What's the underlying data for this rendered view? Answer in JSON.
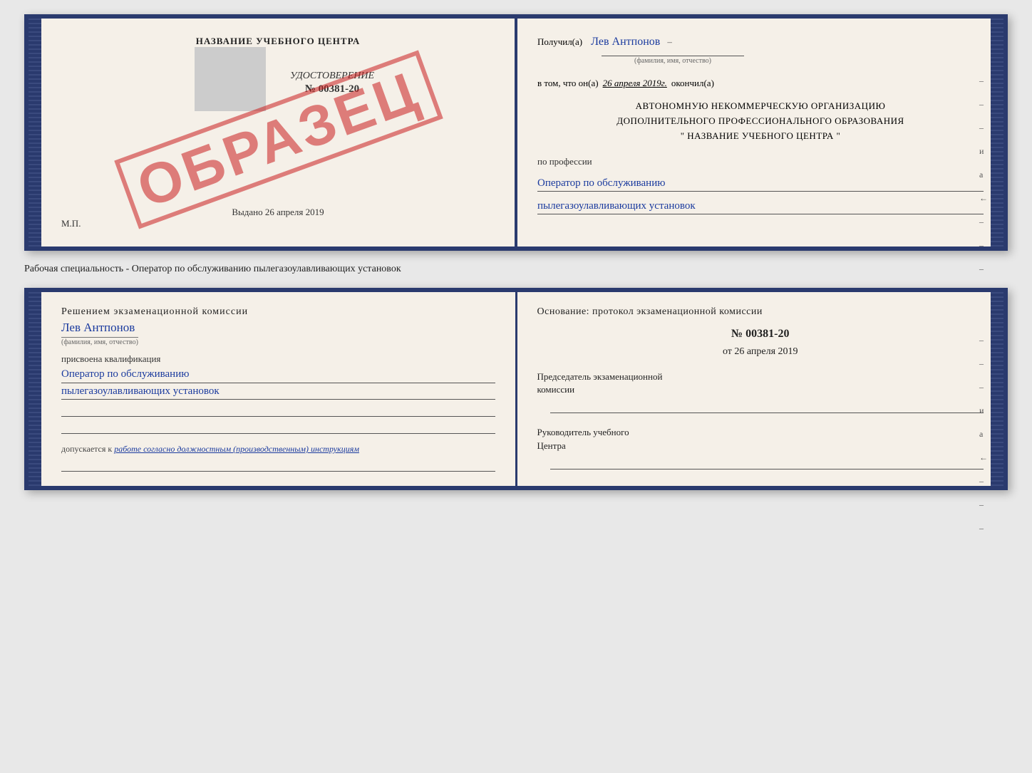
{
  "top_cert": {
    "left": {
      "school_name": "НАЗВАНИЕ УЧЕБНОГО ЦЕНТРА",
      "obrazec": "ОБРАЗЕЦ",
      "udostoverenie_label": "УДОСТОВЕРЕНИЕ",
      "cert_number": "№ 00381-20",
      "vydano": "Выдано 26 апреля 2019",
      "mp": "М.П."
    },
    "right": {
      "poluchil": "Получил(а)",
      "recipient_name": "Лев Антпонов",
      "fio_hint": "(фамилия, имя, отчество)",
      "v_tom_chto": "в том, что он(а)",
      "date": "26 апреля 2019г.",
      "okonchil": "окончил(а)",
      "org_line1": "АВТОНОМНУЮ НЕКОММЕРЧЕСКУЮ ОРГАНИЗАЦИЮ",
      "org_line2": "ДОПОЛНИТЕЛЬНОГО ПРОФЕССИОНАЛЬНОГО ОБРАЗОВАНИЯ",
      "org_line3": "\"  НАЗВАНИЕ УЧЕБНОГО ЦЕНТРА  \"",
      "po_professii": "по профессии",
      "profession_line1": "Оператор по обслуживанию",
      "profession_line2": "пылегазоулавливающих установок",
      "side_marks": [
        "-",
        "-",
        "–",
        "и",
        "а",
        "←",
        "–",
        "–",
        "–"
      ]
    }
  },
  "subtitle": "Рабочая специальность - Оператор по обслуживанию пылегазоулавливающих установок",
  "bottom_cert": {
    "left": {
      "komissia_title": "Решением экзаменационной комиссии",
      "name": "Лев Антпонов",
      "fio_hint": "(фамилия, имя, отчество)",
      "prisvoena": "присвоена квалификация",
      "prof_line1": "Оператор по обслуживанию",
      "prof_line2": "пылегазоулавливающих установок",
      "dopuskaetsya_prefix": "допускается к",
      "dopuskaetsya_value": "работе согласно должностным (производственным) инструкциям"
    },
    "right": {
      "osnova": "Основание: протокол экзаменационной комиссии",
      "protocol_num": "№ 00381-20",
      "ot_label": "от",
      "date": "26 апреля 2019",
      "predsedatel_line1": "Председатель экзаменационной",
      "predsedatel_line2": "комиссии",
      "rukovoditel_line1": "Руководитель учебного",
      "rukovoditel_line2": "Центра",
      "side_marks": [
        "–",
        "–",
        "–",
        "и",
        "а",
        "←",
        "–",
        "–",
        "–"
      ]
    }
  }
}
